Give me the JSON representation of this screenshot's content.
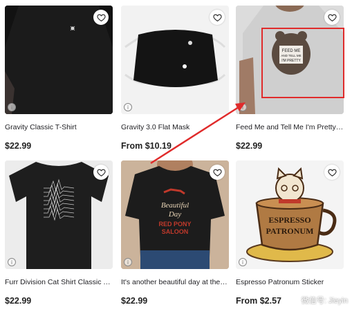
{
  "products": [
    {
      "title": "Gravity Classic T-Shirt",
      "price": "$22.99"
    },
    {
      "title": "Gravity 3.0 Flat Mask",
      "price": "From $10.19"
    },
    {
      "title": "Feed Me and Tell Me I'm Pretty B…",
      "price": "$22.99"
    },
    {
      "title": "Furr Division Cat Shirt Classic T-…",
      "price": "$22.99"
    },
    {
      "title": "It's another beautiful day at the r…",
      "price": "$22.99"
    },
    {
      "title": "Espresso Patronum Sticker",
      "price": "From $2.57"
    }
  ],
  "artwork": {
    "bear_text": "FEED ME AND TELL ME I'M PRETTY",
    "day_text_1": "Beautiful",
    "day_text_2": "Day",
    "day_text_3": "RED PONY",
    "day_text_4": "SALOON",
    "espresso_1": "ESPRESSO",
    "espresso_2": "PATRONUM"
  },
  "watermark": "微信号: Jieyin"
}
